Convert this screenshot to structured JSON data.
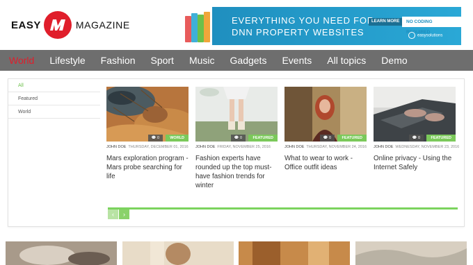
{
  "logo": {
    "left": "EASY",
    "right": "MAGAZINE"
  },
  "banner": {
    "line1": "EVERYTHING YOU NEED FOR",
    "line2": "DNN PROPERTY WEBSITES",
    "learn_more": "LEARN MORE",
    "no_coding": "NO CODING REQUIRED",
    "brand": "easysolutions"
  },
  "nav": {
    "items": [
      {
        "label": "World",
        "active": true
      },
      {
        "label": "Lifestyle"
      },
      {
        "label": "Fashion"
      },
      {
        "label": "Sport"
      },
      {
        "label": "Music"
      },
      {
        "label": "Gadgets"
      },
      {
        "label": "Events"
      },
      {
        "label": "All topics"
      },
      {
        "label": "Demo"
      }
    ]
  },
  "side_filter": {
    "items": [
      {
        "label": "All",
        "active": true
      },
      {
        "label": "Featured"
      },
      {
        "label": "World"
      }
    ]
  },
  "cards": [
    {
      "author": "JOHN DOE",
      "date": "THURSDAY, DECEMBER 01, 2016",
      "comments": "0",
      "category": "WORLD",
      "title": "Mars exploration program - Mars probe searching for life",
      "image": "mars-texture"
    },
    {
      "author": "JOHN DOE",
      "date": "FRIDAY, NOVEMBER 25, 2016",
      "comments": "0",
      "category": "FEATURED",
      "title": "Fashion experts have rounded up the top must-have fashion trends for winter",
      "image": "legs-boots"
    },
    {
      "author": "JOHN DOE",
      "date": "THURSDAY, NOVEMBER 24, 2016",
      "comments": "0",
      "category": "FEATURED",
      "title": "What to wear to work - Office outfit ideas",
      "image": "woman-red-hair"
    },
    {
      "author": "JOHN DOE",
      "date": "WEDNESDAY, NOVEMBER 23, 2016",
      "comments": "0",
      "category": "FEATURED",
      "title": "Online privacy - Using the Internet Safely",
      "image": "laptop-hands"
    }
  ],
  "pager": {
    "prev": "‹",
    "next": "›"
  },
  "colors": {
    "accent_red": "#e01e2b",
    "accent_green": "#7bc95a",
    "nav_bg": "#6e6e6e",
    "banner_blue": "#2aa8d6"
  }
}
